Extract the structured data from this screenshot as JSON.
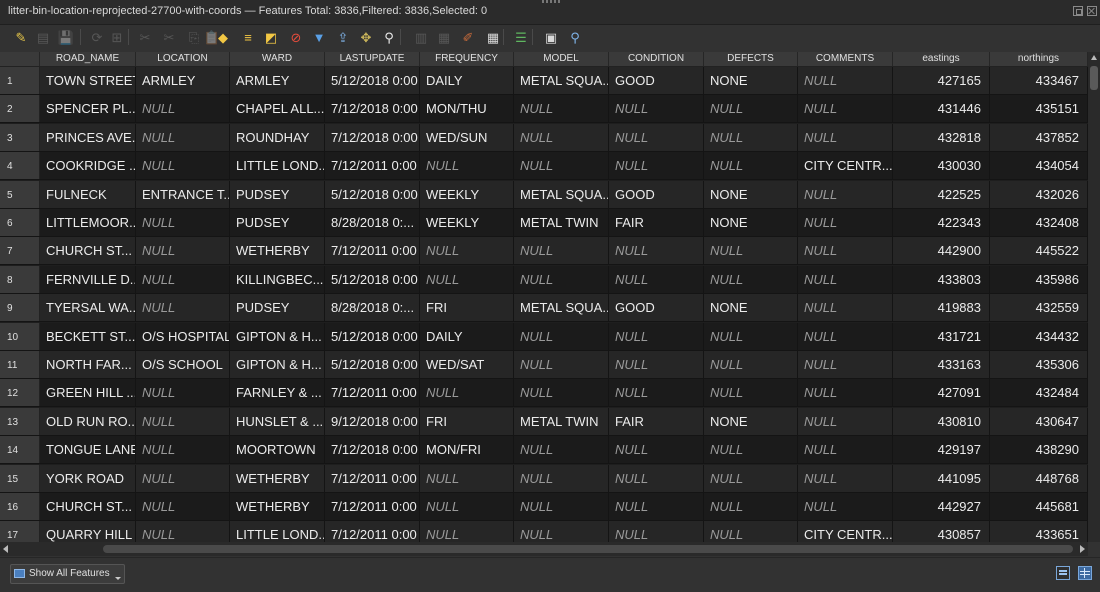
{
  "window": {
    "title": "litter-bin-location-reprojected-27700-with-coords — Features Total: 3836,Filtered: 3836,Selected: 0"
  },
  "toolbar": {
    "buttons": [
      {
        "name": "toggle-editing-icon",
        "glyph": "✎",
        "color": "#e8c84a",
        "dim": false
      },
      {
        "name": "multi-edit-icon",
        "glyph": "▤",
        "color": "#9a9a9a",
        "dim": true
      },
      {
        "name": "save-edits-icon",
        "glyph": "💾",
        "color": "#9a9a9a",
        "dim": true
      },
      {
        "name": "reload-table-icon",
        "glyph": "⟳",
        "color": "#9a9a9a",
        "dim": true
      },
      {
        "name": "add-feature-icon",
        "glyph": "⊞",
        "color": "#9a9a9a",
        "dim": true
      },
      {
        "name": "delete-feature-icon",
        "glyph": "✂",
        "color": "#9a9a9a",
        "dim": true
      },
      {
        "name": "cut-icon",
        "glyph": "✂",
        "color": "#9a9a9a",
        "dim": true
      },
      {
        "name": "copy-icon",
        "glyph": "⎘",
        "color": "#9a9a9a",
        "dim": true
      },
      {
        "name": "paste-icon",
        "glyph": "📋",
        "color": "#9a9a9a",
        "dim": true
      },
      {
        "name": "select-by-expression-icon",
        "glyph": "◆",
        "color": "#f2c744",
        "dim": false
      },
      {
        "name": "select-all-icon",
        "glyph": "≡",
        "color": "#f2c744",
        "dim": false
      },
      {
        "name": "invert-selection-icon",
        "glyph": "◩",
        "color": "#f2c744",
        "dim": false
      },
      {
        "name": "deselect-all-icon",
        "glyph": "⊘",
        "color": "#e74c3c",
        "dim": false
      },
      {
        "name": "filter-icon",
        "glyph": "▼",
        "color": "#5aa0e6",
        "dim": false
      },
      {
        "name": "move-selection-to-top-icon",
        "glyph": "⇪",
        "color": "#7fb3e8",
        "dim": false
      },
      {
        "name": "pan-to-selection-icon",
        "glyph": "✥",
        "color": "#c9b45a",
        "dim": false
      },
      {
        "name": "zoom-to-selection-icon",
        "glyph": "⚲",
        "color": "#e8e8e8",
        "dim": false
      },
      {
        "name": "new-field-icon",
        "glyph": "▥",
        "color": "#9a9a9a",
        "dim": true
      },
      {
        "name": "delete-field-icon",
        "glyph": "▦",
        "color": "#9a9a9a",
        "dim": true
      },
      {
        "name": "field-calculator-icon",
        "glyph": "✐",
        "color": "#c76a3a",
        "dim": false
      },
      {
        "name": "conditional-formatting-icon",
        "glyph": "▦",
        "color": "#d9d9d9",
        "dim": false
      },
      {
        "name": "dock-table-icon",
        "glyph": "☰",
        "color": "#5fb760",
        "dim": false
      },
      {
        "name": "actions-icon",
        "glyph": "▣",
        "color": "#d9d9d9",
        "dim": false
      },
      {
        "name": "zoom-map-icon",
        "glyph": "⚲",
        "color": "#7fb3e8",
        "dim": false
      }
    ]
  },
  "table": {
    "columns": [
      {
        "key": "ROAD_NAME",
        "label": "ROAD_NAME"
      },
      {
        "key": "LOCATION",
        "label": "LOCATION"
      },
      {
        "key": "WARD",
        "label": "WARD"
      },
      {
        "key": "LASTUPDATE",
        "label": "LASTUPDATE"
      },
      {
        "key": "FREQUENCY",
        "label": "FREQUENCY"
      },
      {
        "key": "MODEL",
        "label": "MODEL"
      },
      {
        "key": "CONDITION",
        "label": "CONDITION"
      },
      {
        "key": "DEFECTS",
        "label": "DEFECTS"
      },
      {
        "key": "COMMENTS",
        "label": "COMMENTS"
      },
      {
        "key": "eastings",
        "label": "eastings"
      },
      {
        "key": "northings",
        "label": "northings"
      }
    ],
    "rows": [
      {
        "n": "1",
        "cells": [
          "TOWN STREET",
          "ARMLEY",
          "ARMLEY",
          "5/12/2018 0:00",
          "DAILY",
          "METAL SQUA...",
          "GOOD",
          "NONE",
          "NULL",
          "427165",
          "433467"
        ]
      },
      {
        "n": "2",
        "cells": [
          "SPENCER PL...",
          "NULL",
          "CHAPEL ALL...",
          "7/12/2018 0:00",
          "MON/THU",
          "NULL",
          "NULL",
          "NULL",
          "NULL",
          "431446",
          "435151"
        ]
      },
      {
        "n": "3",
        "cells": [
          "PRINCES AVE...",
          "NULL",
          "ROUNDHAY",
          "7/12/2018 0:00",
          "WED/SUN",
          "NULL",
          "NULL",
          "NULL",
          "NULL",
          "432818",
          "437852"
        ]
      },
      {
        "n": "4",
        "cells": [
          "COOKRIDGE ...",
          "NULL",
          "LITTLE LOND...",
          "7/12/2011 0:00",
          "NULL",
          "NULL",
          "NULL",
          "NULL",
          "CITY CENTR...",
          "430030",
          "434054"
        ]
      },
      {
        "n": "5",
        "cells": [
          "FULNECK",
          "ENTRANCE T...",
          "PUDSEY",
          "5/12/2018 0:00",
          "WEEKLY",
          "METAL SQUA...",
          "GOOD",
          "NONE",
          "NULL",
          "422525",
          "432026"
        ]
      },
      {
        "n": "6",
        "cells": [
          "LITTLEMOOR...",
          "NULL",
          "PUDSEY",
          "8/28/2018 0:...",
          "WEEKLY",
          "METAL TWIN",
          "FAIR",
          "NONE",
          "NULL",
          "422343",
          "432408"
        ]
      },
      {
        "n": "7",
        "cells": [
          "CHURCH ST...",
          "NULL",
          "WETHERBY",
          "7/12/2011 0:00",
          "NULL",
          "NULL",
          "NULL",
          "NULL",
          "NULL",
          "442900",
          "445522"
        ]
      },
      {
        "n": "8",
        "cells": [
          "FERNVILLE D...",
          "NULL",
          "KILLINGBEC...",
          "5/12/2018 0:00",
          "NULL",
          "NULL",
          "NULL",
          "NULL",
          "NULL",
          "433803",
          "435986"
        ]
      },
      {
        "n": "9",
        "cells": [
          "TYERSAL WA...",
          "NULL",
          "PUDSEY",
          "8/28/2018 0:...",
          "FRI",
          "METAL SQUA...",
          "GOOD",
          "NONE",
          "NULL",
          "419883",
          "432559"
        ]
      },
      {
        "n": "10",
        "cells": [
          "BECKETT ST...",
          "O/S HOSPITAL",
          "GIPTON & H...",
          "5/12/2018 0:00",
          "DAILY",
          "NULL",
          "NULL",
          "NULL",
          "NULL",
          "431721",
          "434432"
        ]
      },
      {
        "n": "11",
        "cells": [
          "NORTH FAR...",
          "O/S SCHOOL",
          "GIPTON & H...",
          "5/12/2018 0:00",
          "WED/SAT",
          "NULL",
          "NULL",
          "NULL",
          "NULL",
          "433163",
          "435306"
        ]
      },
      {
        "n": "12",
        "cells": [
          "GREEN HILL ...",
          "NULL",
          "FARNLEY & ...",
          "7/12/2011 0:00",
          "NULL",
          "NULL",
          "NULL",
          "NULL",
          "NULL",
          "427091",
          "432484"
        ]
      },
      {
        "n": "13",
        "cells": [
          "OLD RUN RO...",
          "NULL",
          "HUNSLET & ...",
          "9/12/2018 0:00",
          "FRI",
          "METAL TWIN",
          "FAIR",
          "NONE",
          "NULL",
          "430810",
          "430647"
        ]
      },
      {
        "n": "14",
        "cells": [
          "TONGUE LANE",
          "NULL",
          "MOORTOWN",
          "7/12/2018 0:00",
          "MON/FRI",
          "NULL",
          "NULL",
          "NULL",
          "NULL",
          "429197",
          "438290"
        ]
      },
      {
        "n": "15",
        "cells": [
          "YORK ROAD",
          "NULL",
          "WETHERBY",
          "7/12/2011 0:00",
          "NULL",
          "NULL",
          "NULL",
          "NULL",
          "NULL",
          "441095",
          "448768"
        ]
      },
      {
        "n": "16",
        "cells": [
          "CHURCH ST...",
          "NULL",
          "WETHERBY",
          "7/12/2011 0:00",
          "NULL",
          "NULL",
          "NULL",
          "NULL",
          "NULL",
          "442927",
          "445681"
        ]
      },
      {
        "n": "17",
        "cells": [
          "QUARRY HILL",
          "NULL",
          "LITTLE LOND...",
          "7/12/2011 0:00",
          "NULL",
          "NULL",
          "NULL",
          "NULL",
          "CITY CENTR...",
          "430857",
          "433651"
        ]
      }
    ]
  },
  "footer": {
    "show_all_label": "Show All Features"
  }
}
